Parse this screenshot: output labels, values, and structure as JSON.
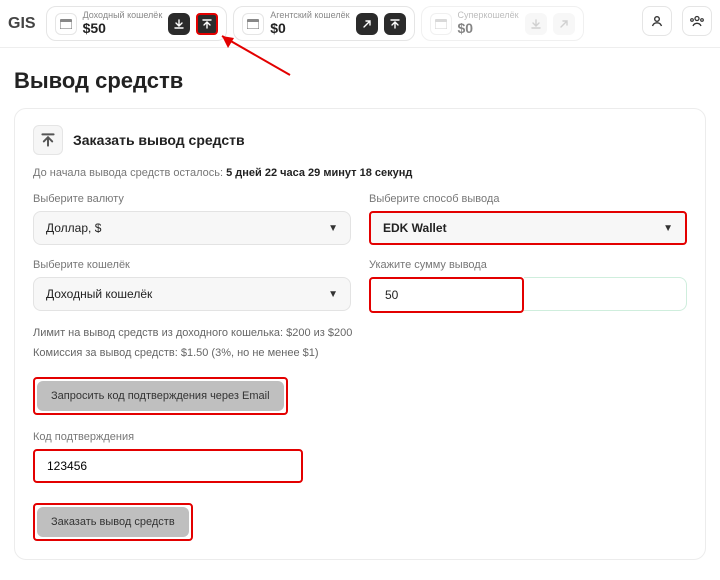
{
  "logo": "GIS",
  "topbar": {
    "wallets": [
      {
        "name": "Доходный кошелёк",
        "amount": "$50"
      },
      {
        "name": "Агентский кошелёк",
        "amount": "$0"
      },
      {
        "name": "Суперкошелёк",
        "amount": "$0"
      }
    ]
  },
  "page_title": "Вывод средств",
  "panel": {
    "title": "Заказать вывод средств",
    "countdown_prefix": "До начала вывода средств осталось:",
    "countdown_value": "5 дней 22 часа 29 минут 18 секунд",
    "currency_label": "Выберите валюту",
    "currency_value": "Доллар, $",
    "method_label": "Выберите способ вывода",
    "method_value": "EDK Wallet",
    "wallet_label": "Выберите кошелёк",
    "wallet_value": "Доходный кошелёк",
    "amount_label": "Укажите сумму вывода",
    "amount_value": "50",
    "limit_line": "Лимит на вывод средств из доходного кошелька: $200 из $200",
    "fee_line": "Комиссия за вывод средств: $1.50 (3%, но не менее $1)",
    "request_code_btn": "Запросить код подтверждения через Email",
    "code_label": "Код подтверждения",
    "code_value": "123456",
    "submit_btn": "Заказать вывод средств"
  }
}
